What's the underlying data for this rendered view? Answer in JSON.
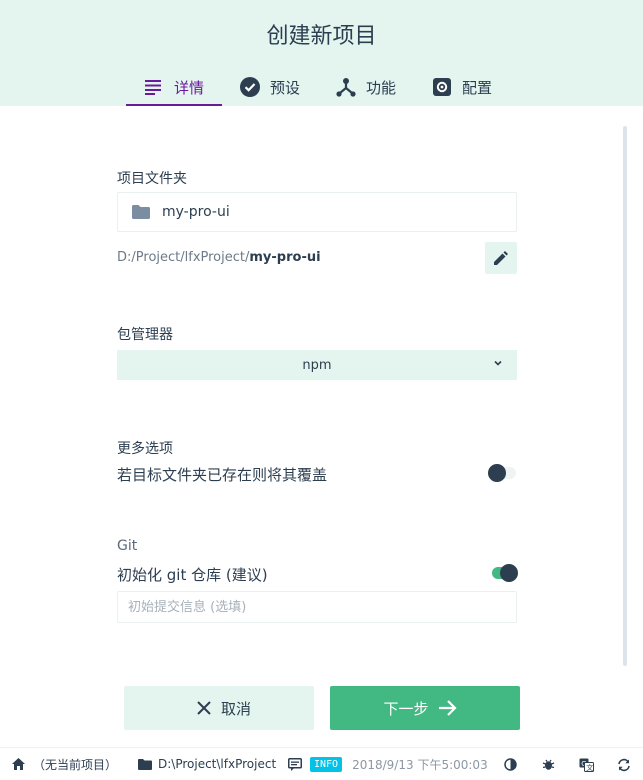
{
  "header": {
    "title": "创建新项目"
  },
  "tabs": [
    {
      "label": "详情",
      "icon": "details-icon",
      "active": true
    },
    {
      "label": "预设",
      "icon": "check-circle-icon"
    },
    {
      "label": "功能",
      "icon": "device-hub-icon"
    },
    {
      "label": "配置",
      "icon": "settings-icon"
    }
  ],
  "folder": {
    "label": "项目文件夹",
    "value": "my-pro-ui",
    "path_prefix": "D:/Project/lfxProject/",
    "path_name": "my-pro-ui"
  },
  "package_manager": {
    "label": "包管理器",
    "selected": "npm"
  },
  "options": {
    "label": "更多选项",
    "overwrite_label": "若目标文件夹已存在则将其覆盖",
    "overwrite_enabled": false
  },
  "git": {
    "label": "Git",
    "init_label": "初始化 git 仓库 (建议)",
    "init_enabled": true,
    "commit_placeholder": "初始提交信息 (选填)",
    "commit_value": ""
  },
  "actions": {
    "cancel_label": "取消",
    "next_label": "下一步"
  },
  "statusbar": {
    "current_project": "（无当前项目）",
    "cwd": "D:\\Project\\lfxProject",
    "log_level": "INFO",
    "timestamp": "2018/9/13  下午5:00:03"
  },
  "colors": {
    "accent": "#42b983",
    "tab_active": "#6a1b9a",
    "header_bg": "#e4f5ef",
    "badge": "#03c2e6"
  }
}
